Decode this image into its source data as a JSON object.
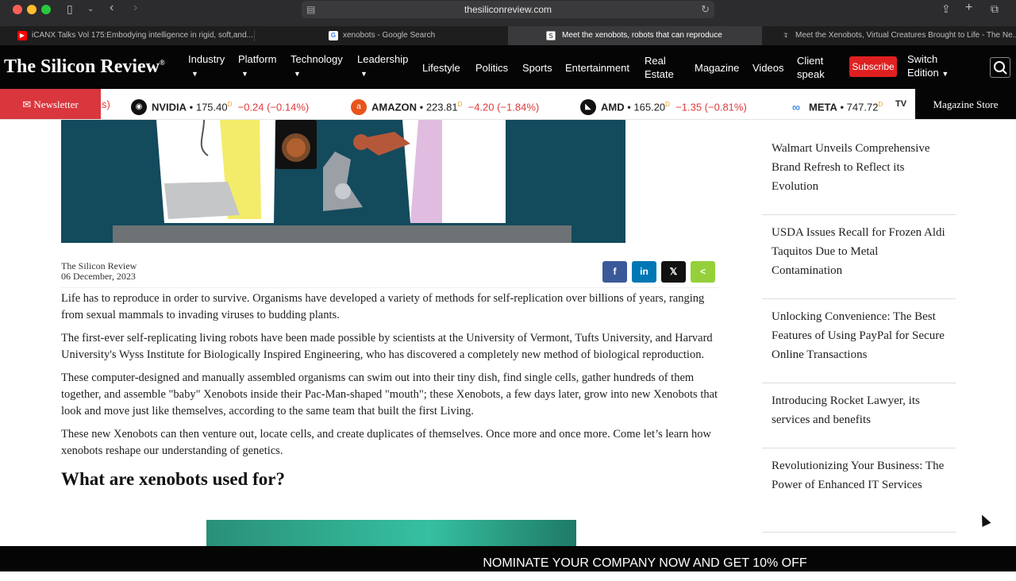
{
  "browser": {
    "url": "thesiliconreview.com",
    "tabs": [
      {
        "title": "iCANX Talks Vol 175:Embodying intelligence in rigid, soft,and...",
        "favicon_color": "#ff0000"
      },
      {
        "title": "xenobots - Google Search",
        "favicon_color": "#4285f4"
      },
      {
        "title": "Meet the xenobots, robots that can reproduce",
        "favicon_color": "#111111"
      },
      {
        "title": "Meet the Xenobots, Virtual Creatures Brought to Life - The Ne...",
        "favicon_color": "#111111"
      }
    ]
  },
  "site": {
    "logo": "The Silicon Review",
    "logo_mark": "®",
    "nav": [
      {
        "label": "Industry"
      },
      {
        "label": "Platform"
      },
      {
        "label": "Technology"
      },
      {
        "label": "Leadership"
      },
      {
        "label": "Lifestyle"
      },
      {
        "label": "Politics"
      },
      {
        "label": "Sports"
      },
      {
        "label": "Entertainment"
      },
      {
        "label": "Real",
        "label2": "Estate"
      },
      {
        "label": "Magazine"
      },
      {
        "label": "Videos"
      },
      {
        "label": "Client",
        "label2": "speak"
      },
      {
        "label": "Switch",
        "label2": "Edition"
      }
    ],
    "subscribe_label": "Subscribe",
    "newsletter_label": "Newsletter",
    "magazine_store_label": "Magazine Store"
  },
  "ticker": [
    {
      "symbol": "NVIDIA",
      "price": "175.40",
      "change": "−0.24 (−0.14%)",
      "logo_color": "#111111",
      "badge": "D"
    },
    {
      "symbol": "AMAZON",
      "price": "223.81",
      "change": "−4.20 (−1.84%)",
      "logo_color": "#e8541c",
      "badge": "D"
    },
    {
      "symbol": "AMD",
      "price": "165.20",
      "change": "−1.35 (−0.81%)",
      "logo_color": "#111111",
      "badge": "D"
    },
    {
      "symbol": "META",
      "price": "747.72",
      "change": "",
      "logo_color": "#0668e1",
      "badge": "D"
    }
  ],
  "ticker_fragment": "s)",
  "article": {
    "author": "The Silicon Review",
    "date": "06 December, 2023",
    "paragraphs": [
      "Life has to reproduce in order to survive. Organisms have developed a variety of methods for self-replication over billions of years, ranging from sexual mammals to invading viruses to budding plants.",
      "The first-ever self-replicating living robots have been made possible by scientists at the University of Vermont, Tufts University, and Harvard University's Wyss Institute for Biologically Inspired Engineering, who has discovered a completely new method of biological reproduction.",
      "These computer-designed and manually assembled organisms can swim out into their tiny dish, find single cells, gather hundreds of them together, and assemble \"baby\" Xenobots inside their Pac-Man-shaped \"mouth\"; these Xenobots, a few days later, grow into new Xenobots that look and move just like themselves, according to the same team that built the first Living.",
      "These new Xenobots can then venture out, locate cells, and create duplicates of themselves. Once more and once more. Come let’s learn how xenobots reshape our understanding of genetics."
    ],
    "heading": "What are xenobots used for?",
    "share": [
      {
        "icon": "facebook-icon",
        "glyph": "f",
        "color": "#3b5998"
      },
      {
        "icon": "linkedin-icon",
        "glyph": "in",
        "color": "#0077b5"
      },
      {
        "icon": "x-icon",
        "glyph": "𝕏",
        "color": "#111111"
      },
      {
        "icon": "share-icon",
        "glyph": "<",
        "color": "#95d03a"
      }
    ]
  },
  "sidebar": [
    {
      "title": "Walmart Unveils Comprehensive Brand Refresh to Reflect its Evolution"
    },
    {
      "title": "USDA Issues Recall for Frozen Aldi Taquitos Due to Metal Contamination"
    },
    {
      "title": "Unlocking Convenience: The Best Features of Using PayPal for Secure Online Transactions"
    },
    {
      "title": "Introducing Rocket Lawyer, its services and benefits"
    },
    {
      "title": "Revolutionizing Your Business: The Power of Enhanced IT Services"
    }
  ],
  "banner": "NOMINATE YOUR COMPANY NOW AND GET 10% OFF"
}
